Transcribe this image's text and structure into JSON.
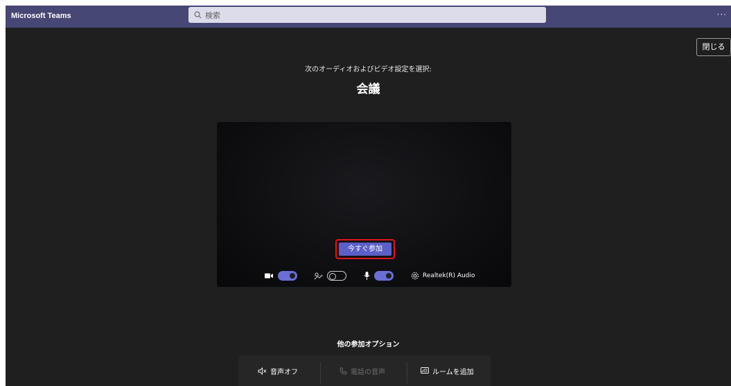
{
  "titlebar": {
    "app_title": "Microsoft Teams",
    "search_placeholder": "検索",
    "more_label": "···"
  },
  "close_label": "閉じる",
  "prejoin": {
    "subtitle": "次のオーディオおよびビデオ設定を選択:",
    "meeting_title": "会議",
    "join_label": "今すぐ参加",
    "camera_on": true,
    "background_effects_on": false,
    "mic_on": true,
    "audio_device": "Realtek(R) Audio"
  },
  "other_options": {
    "title": "他の参加オプション",
    "items": [
      {
        "label": "音声オフ",
        "icon": "speaker-off-icon",
        "enabled": true
      },
      {
        "label": "電話の音声",
        "icon": "phone-icon",
        "enabled": false
      },
      {
        "label": "ルームを追加",
        "icon": "cast-icon",
        "enabled": true
      }
    ]
  },
  "colors": {
    "titlebar": "#464775",
    "accent": "#5b5fc7",
    "highlight": "#e0141e",
    "background": "#1f1f1f"
  }
}
